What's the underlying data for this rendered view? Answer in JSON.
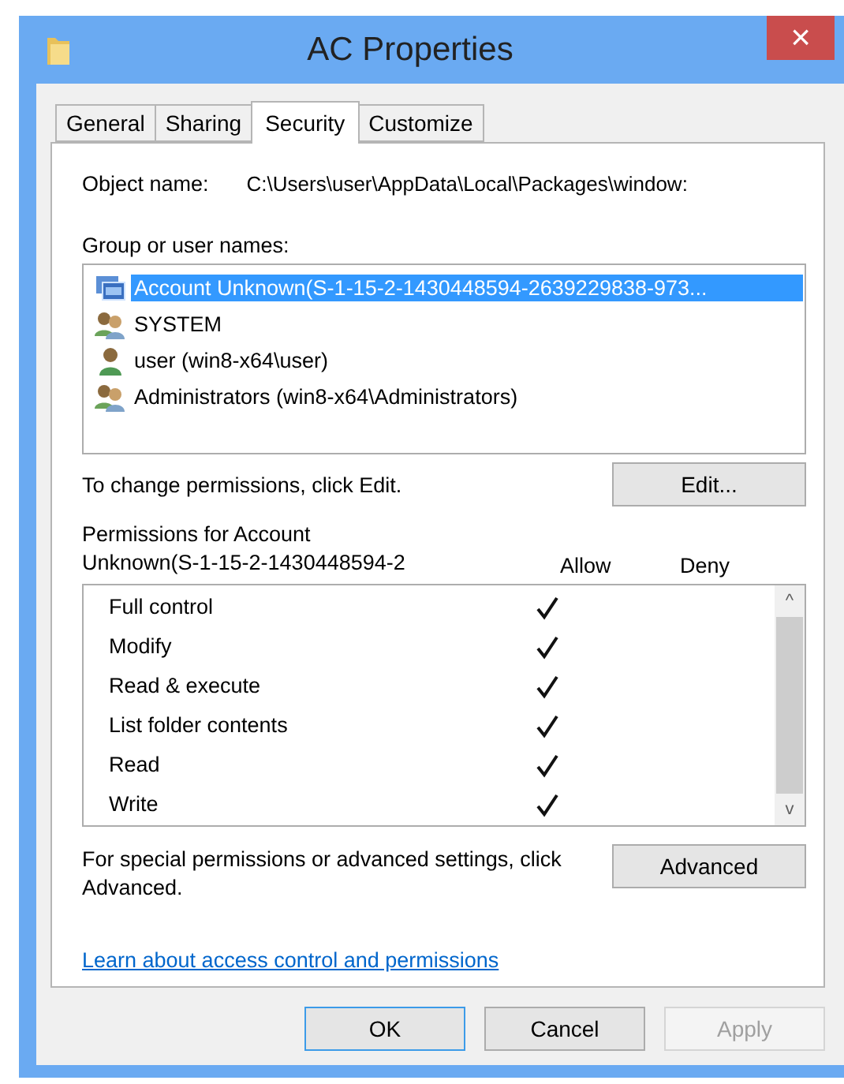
{
  "window": {
    "title": "AC Properties",
    "close": "×"
  },
  "tabs": [
    {
      "label": "General",
      "selected": false
    },
    {
      "label": "Sharing",
      "selected": false
    },
    {
      "label": "Security",
      "selected": true
    },
    {
      "label": "Customize",
      "selected": false
    }
  ],
  "object_name": {
    "label": "Object name:",
    "value": "C:\\Users\\user\\AppData\\Local\\Packages\\window:"
  },
  "group_list": {
    "label": "Group or user names:",
    "items": [
      {
        "name": "Account Unknown(S-1-15-2-1430448594-2639229838-973...",
        "kind": "unknown",
        "selected": true
      },
      {
        "name": "SYSTEM",
        "kind": "group",
        "selected": false
      },
      {
        "name": "user (win8-x64\\user)",
        "kind": "user",
        "selected": false
      },
      {
        "name": "Administrators (win8-x64\\Administrators)",
        "kind": "group",
        "selected": false
      }
    ]
  },
  "change_hint": "To change permissions, click Edit.",
  "edit_button": "Edit...",
  "permissions": {
    "label_line_1": "Permissions for Account",
    "label_line_2": "Unknown(S-1-15-2-1430448594-2",
    "allow_header": "Allow",
    "deny_header": "Deny",
    "up_arrow": "^",
    "down_arrow": "v",
    "rows": [
      {
        "name": "Full control",
        "allow": true,
        "deny": false
      },
      {
        "name": "Modify",
        "allow": true,
        "deny": false
      },
      {
        "name": "Read & execute",
        "allow": true,
        "deny": false
      },
      {
        "name": "List folder contents",
        "allow": true,
        "deny": false
      },
      {
        "name": "Read",
        "allow": true,
        "deny": false
      },
      {
        "name": "Write",
        "allow": true,
        "deny": false
      }
    ]
  },
  "advanced_hint": "For special permissions or advanced settings, click Advanced.",
  "advanced_button": "Advanced",
  "link": "Learn about access control and permissions",
  "buttons": [
    {
      "label": "OK",
      "disabled": false,
      "default": true
    },
    {
      "label": "Cancel",
      "disabled": false,
      "default": false
    },
    {
      "label": "Apply",
      "disabled": true,
      "default": false
    }
  ]
}
